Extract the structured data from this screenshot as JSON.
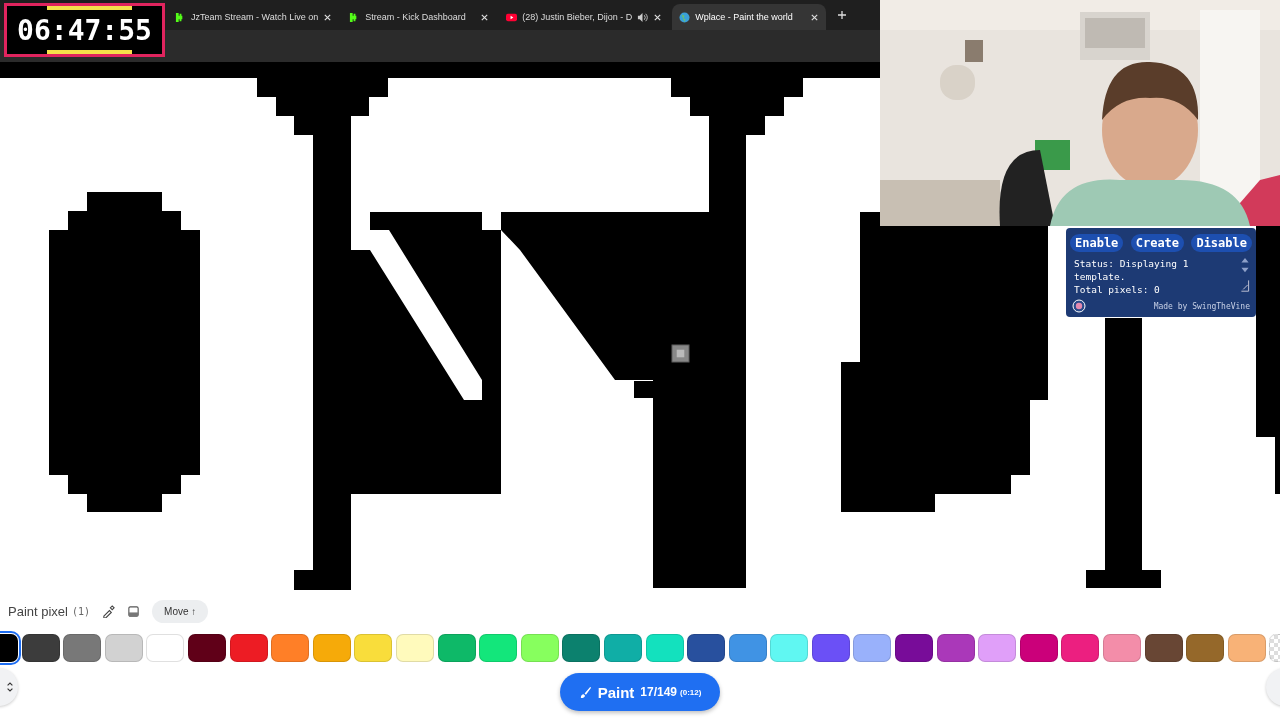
{
  "timer": {
    "text": "06:47:55"
  },
  "tabs": [
    {
      "label": "JzTeam Stream - Watch Live on",
      "kind": "green",
      "audio": false,
      "selected": false
    },
    {
      "label": "Stream - Kick Dashboard",
      "kind": "green",
      "audio": false,
      "selected": false
    },
    {
      "label": "(28) Justin Bieber, Dijon - D",
      "kind": "video",
      "audio": true,
      "selected": false
    },
    {
      "label": "Wplace - Paint the world",
      "kind": "globe",
      "audio": false,
      "selected": true
    }
  ],
  "template_panel": {
    "buttons": [
      "Enable",
      "Create",
      "Disable"
    ],
    "status": "Status: Displaying 1 template.",
    "total": "Total pixels: 0",
    "credit": "Made by SwingTheVine"
  },
  "paint_bar": {
    "title": "Paint pixel",
    "count": "(1)",
    "move_button": "Move ↑",
    "palette": [
      {
        "kind": "color",
        "color": "#000000",
        "selected": true
      },
      {
        "kind": "color",
        "color": "#3c3c3c",
        "selected": false
      },
      {
        "kind": "color",
        "color": "#787878",
        "selected": false
      },
      {
        "kind": "color",
        "color": "#d2d2d2",
        "selected": false
      },
      {
        "kind": "color",
        "color": "#ffffff",
        "selected": false
      },
      {
        "kind": "color",
        "color": "#600018",
        "selected": false
      },
      {
        "kind": "color",
        "color": "#ed1c24",
        "selected": false
      },
      {
        "kind": "color",
        "color": "#ff7f27",
        "selected": false
      },
      {
        "kind": "color",
        "color": "#f6aa09",
        "selected": false
      },
      {
        "kind": "color",
        "color": "#f9dd3b",
        "selected": false
      },
      {
        "kind": "color",
        "color": "#fffabc",
        "selected": false
      },
      {
        "kind": "color",
        "color": "#0eb968",
        "selected": false
      },
      {
        "kind": "color",
        "color": "#13e67b",
        "selected": false
      },
      {
        "kind": "color",
        "color": "#87ff5e",
        "selected": false
      },
      {
        "kind": "color",
        "color": "#0c816e",
        "selected": false
      },
      {
        "kind": "color",
        "color": "#10aea6",
        "selected": false
      },
      {
        "kind": "color",
        "color": "#13e1be",
        "selected": false
      },
      {
        "kind": "color",
        "color": "#28509e",
        "selected": false
      },
      {
        "kind": "color",
        "color": "#4093e4",
        "selected": false
      },
      {
        "kind": "color",
        "color": "#60f7f2",
        "selected": false
      },
      {
        "kind": "color",
        "color": "#6b50f6",
        "selected": false
      },
      {
        "kind": "color",
        "color": "#99b1fb",
        "selected": false
      },
      {
        "kind": "color",
        "color": "#780c99",
        "selected": false
      },
      {
        "kind": "color",
        "color": "#aa38b9",
        "selected": false
      },
      {
        "kind": "color",
        "color": "#e09ff9",
        "selected": false
      },
      {
        "kind": "color",
        "color": "#cb007a",
        "selected": false
      },
      {
        "kind": "color",
        "color": "#ec1f80",
        "selected": false
      },
      {
        "kind": "color",
        "color": "#f38da9",
        "selected": false
      },
      {
        "kind": "color",
        "color": "#684634",
        "selected": false
      },
      {
        "kind": "color",
        "color": "#95682a",
        "selected": false
      },
      {
        "kind": "color",
        "color": "#f8b277",
        "selected": false
      },
      {
        "kind": "transparent",
        "selected": false
      }
    ],
    "paint_button": {
      "label": "Paint",
      "charges": "17/149",
      "cooldown": "(0:12)"
    }
  }
}
